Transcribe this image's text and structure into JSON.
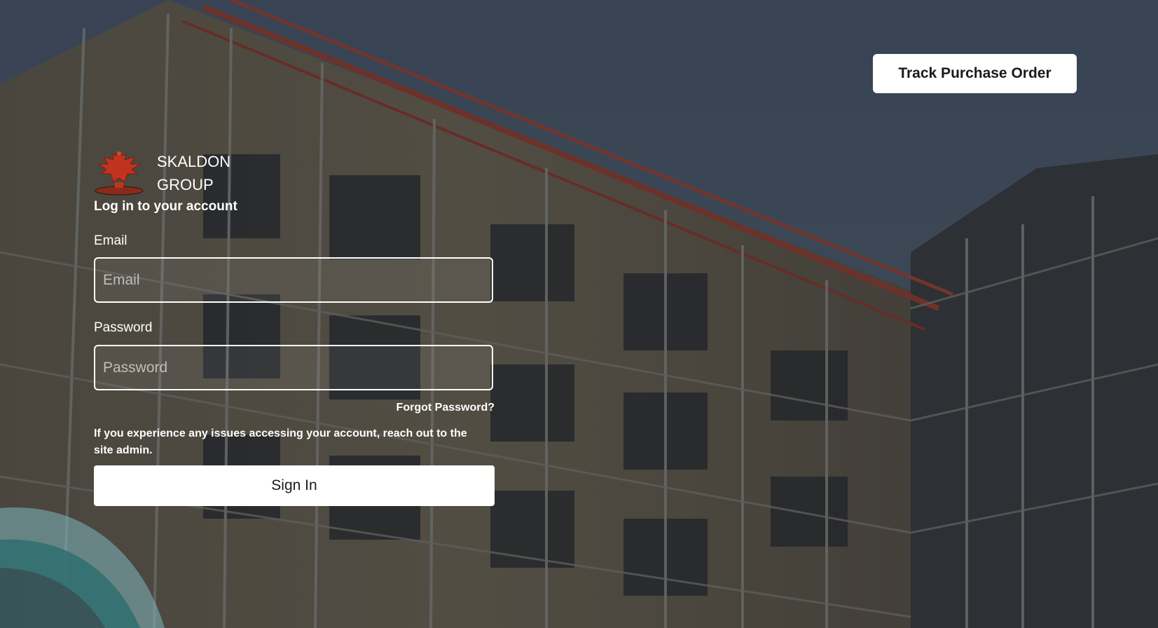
{
  "header": {
    "track_button_label": "Track Purchase Order"
  },
  "brand": {
    "line1": "SKALDON",
    "line2": "GROUP",
    "logo_icon": "eagle-crest-icon"
  },
  "login": {
    "heading": "Log in to your account",
    "email_label": "Email",
    "email_placeholder": "Email",
    "email_value": "",
    "password_label": "Password",
    "password_placeholder": "Password",
    "password_value": "",
    "forgot_label": "Forgot Password?",
    "notice": "If you experience any issues accessing your account, reach out to the site admin.",
    "signin_label": "Sign In"
  },
  "colors": {
    "accent_teal": "#2f6f70",
    "logo_red": "#c0341f",
    "button_bg": "#ffffff"
  }
}
